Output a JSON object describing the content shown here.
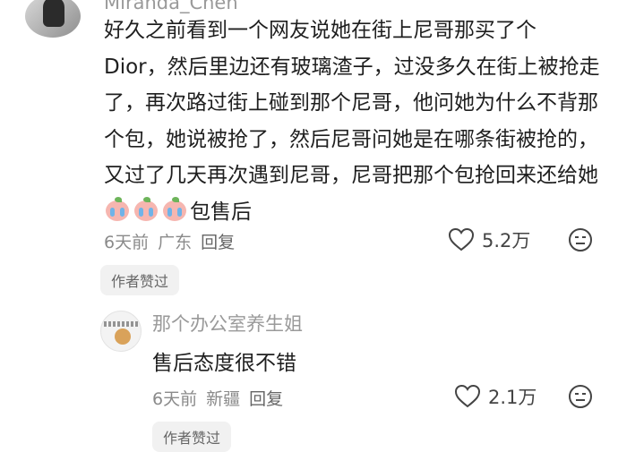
{
  "comment": {
    "username": "Miranda_Chen",
    "text": "好久之前看到一个网友说她在街上尼哥那买了个 Dior，然后里边还有玻璃渣子，过没多久在街上被抢走了，再次路过街上碰到那个尼哥，他问她为什么不背那个包，她说被抢了，然后尼哥问她是在哪条街被抢的，又过了几天再次遇到尼哥，尼哥把那个包抢回来还给她",
    "text_tail": "包售后",
    "emoji": [
      "crying-peach-emoji",
      "crying-peach-emoji",
      "crying-peach-emoji"
    ],
    "time": "6天前",
    "location": "广东",
    "reply_label": "回复",
    "like_count": "5.2万",
    "author_liked": "作者赞过"
  },
  "reply": {
    "username": "那个办公室养生姐",
    "text": "售后态度很不错",
    "time": "6天前",
    "location": "新疆",
    "reply_label": "回复",
    "like_count": "2.1万",
    "author_liked": "作者赞过"
  },
  "icons": {
    "like": "heart-outline-icon",
    "dislike": "meh-face-icon"
  }
}
